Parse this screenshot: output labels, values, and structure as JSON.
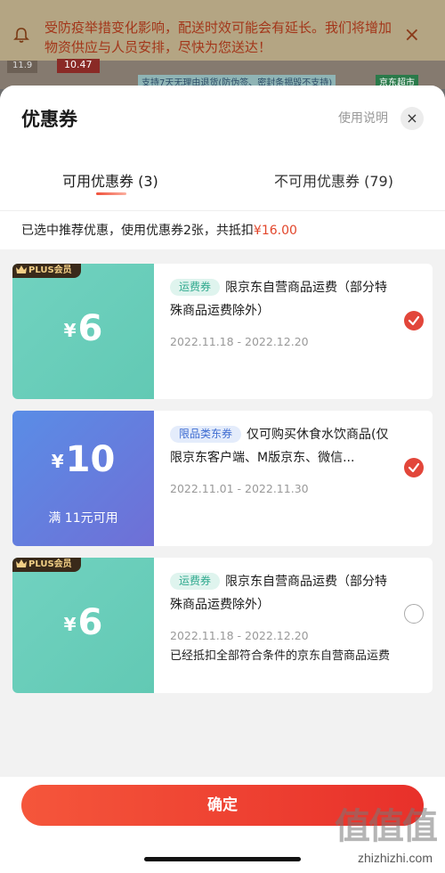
{
  "background_page": {
    "notice": "受防疫举措变化影响，配送时效可能会有延长。我们将增加物资供应与人员安排，尽快为您送达！",
    "price_small": "11.9",
    "price_highlight": "10.47",
    "tags_text": "支持7天无理由退货(防伪签、密封条揭毁不支持)",
    "tag_green": "京东超市"
  },
  "sheet": {
    "title": "优惠券",
    "help_label": "使用说明",
    "close_label": "×",
    "tabs": [
      {
        "label": "可用优惠券 (3)",
        "active": true
      },
      {
        "label": "不可用优惠券 (79)",
        "active": false
      }
    ],
    "summary_text": "已选中推荐优惠，使用优惠券2张，共抵扣",
    "summary_amount": "¥16.00"
  },
  "coupons": [
    {
      "badge": "PLUS会员",
      "currency": "¥",
      "amount": "6",
      "threshold": "",
      "tag": "运费券",
      "description": "限京东自营商品运费（部分特殊商品运费除外）",
      "date": "2022.11.18 - 2022.12.20",
      "note": "",
      "selected": true
    },
    {
      "badge": "",
      "currency": "¥",
      "amount": "10",
      "threshold": "满 11元可用",
      "tag": "限品类东券",
      "description": "仅可购买休食水饮商品(仅限京东客户端、M版京东、微信...",
      "date": "2022.11.01 - 2022.11.30",
      "note": "",
      "selected": true
    },
    {
      "badge": "PLUS会员",
      "currency": "¥",
      "amount": "6",
      "threshold": "",
      "tag": "运费券",
      "description": "限京东自营商品运费（部分特殊商品运费除外）",
      "date": "2022.11.18 - 2022.12.20",
      "note": "已经抵扣全部符合条件的京东自营商品运费",
      "selected": false
    }
  ],
  "footer": {
    "confirm_label": "确定"
  },
  "watermark": {
    "logo": "值值值",
    "url": "zhizhizhi.com"
  },
  "colors": {
    "accent": "#e2462b",
    "teal": "#66ccb8",
    "blue": "#6480e0"
  }
}
